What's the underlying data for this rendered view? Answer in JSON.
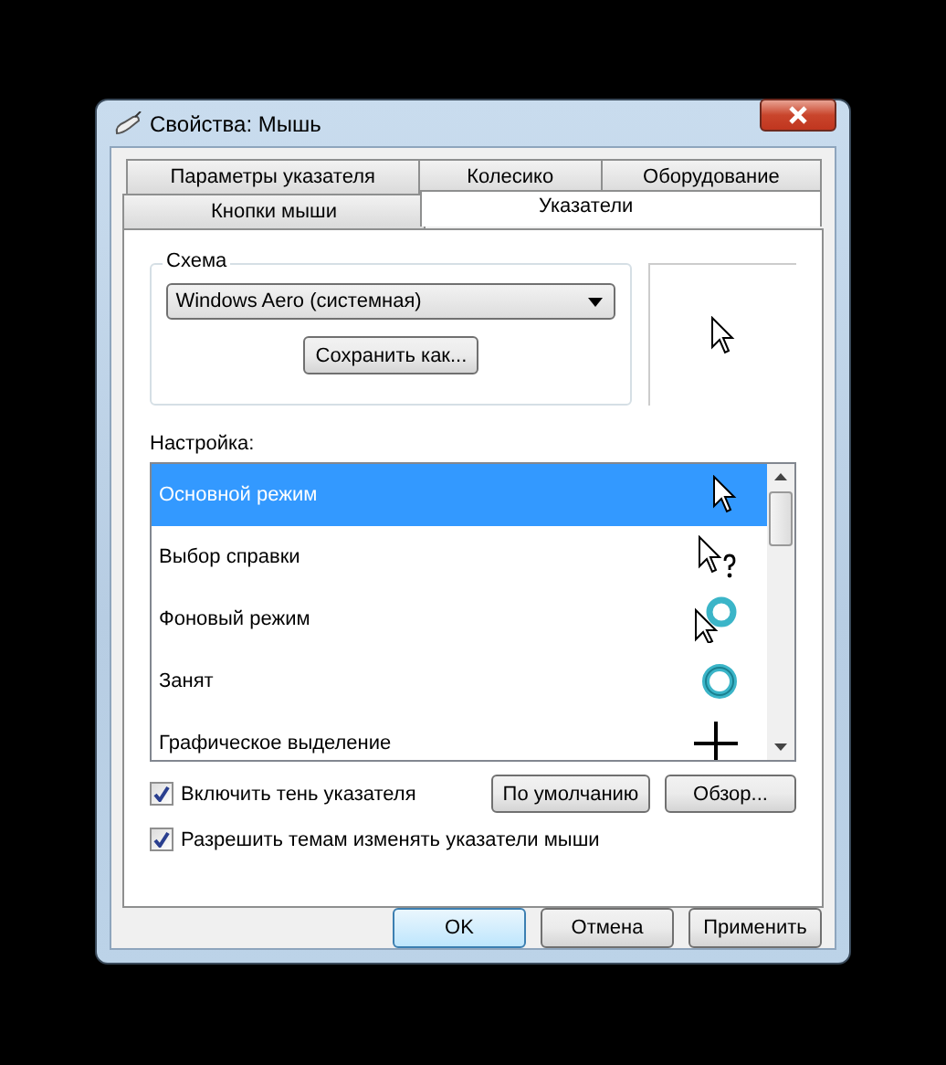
{
  "window": {
    "title": "Свойства: Мышь"
  },
  "tabs": [
    [
      {
        "label": "Параметры указателя",
        "selected": false
      },
      {
        "label": "Колесико",
        "selected": false
      },
      {
        "label": "Оборудование",
        "selected": false
      }
    ],
    [
      {
        "label": "Кнопки мыши",
        "selected": false
      },
      {
        "label": "Указатели",
        "selected": true
      }
    ]
  ],
  "scheme": {
    "label": "Схема",
    "value": "Windows Aero (системная)",
    "save_button": "Сохранить как..."
  },
  "preview": {
    "kind": "arrow"
  },
  "settings": {
    "label": "Настройка:",
    "items": [
      {
        "name": "Основной режим",
        "kind": "arrow",
        "selected": true
      },
      {
        "name": "Выбор справки",
        "kind": "help",
        "selected": false
      },
      {
        "name": "Фоновый режим",
        "kind": "working",
        "selected": false
      },
      {
        "name": "Занят",
        "kind": "busy",
        "selected": false
      },
      {
        "name": "Графическое выделение",
        "kind": "cross",
        "selected": false
      }
    ]
  },
  "options": [
    {
      "label": "Включить тень указателя",
      "checked": true
    },
    {
      "label": "Разрешить темам изменять указатели мыши",
      "checked": true
    }
  ],
  "list_buttons": [
    "По умолчанию",
    "Обзор..."
  ],
  "buttons": [
    {
      "label": "OK",
      "default": true
    },
    {
      "label": "Отмена",
      "default": false
    },
    {
      "label": "Применить",
      "default": false
    }
  ]
}
